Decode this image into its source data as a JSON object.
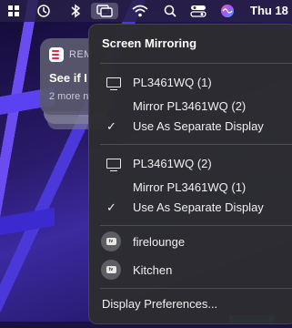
{
  "menubar": {
    "icons": [
      "app-grid-icon",
      "time-machine-icon",
      "bluetooth-icon",
      "screen-mirroring-icon",
      "wifi-icon",
      "search-icon",
      "control-center-icon",
      "siri-icon"
    ],
    "clock": "Thu 18"
  },
  "notification": {
    "app_name": "REM",
    "title": "See if I",
    "more": "2 more n"
  },
  "menu": {
    "header": "Screen Mirroring",
    "groups": [
      {
        "display": "PL3461WQ (1)",
        "mirror_label": "Mirror PL3461WQ (2)",
        "separate_label": "Use As Separate Display",
        "separate_checked": true
      },
      {
        "display": "PL3461WQ (2)",
        "mirror_label": "Mirror PL3461WQ (1)",
        "separate_label": "Use As Separate Display",
        "separate_checked": true
      }
    ],
    "airplay_devices": [
      "firelounge",
      "Kitchen"
    ],
    "airplay_badge": "tv",
    "footer": "Display Preferences..."
  }
}
